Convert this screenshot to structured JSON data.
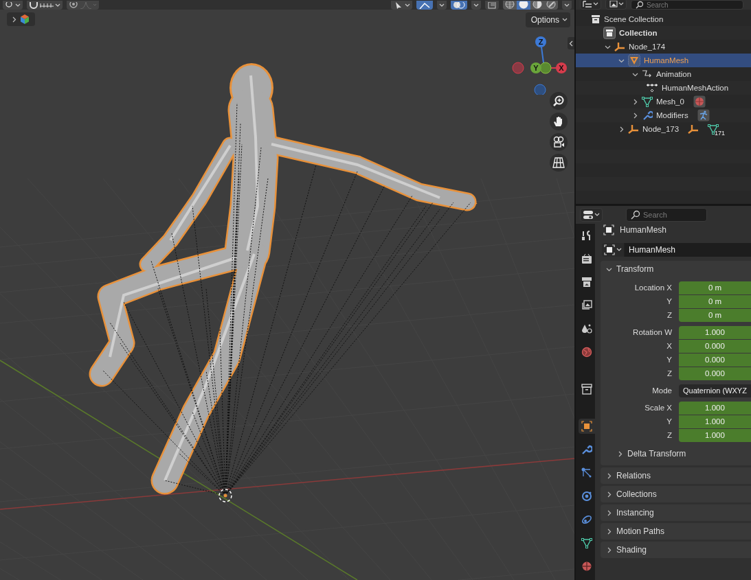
{
  "viewport": {
    "shading_modes": [
      {
        "kind": "wireframe",
        "selected": false
      },
      {
        "kind": "solid",
        "selected": true
      },
      {
        "kind": "material",
        "selected": false
      },
      {
        "kind": "rendered",
        "selected": false
      }
    ],
    "options_button": "Options",
    "toolbar_expanded": false,
    "gizmos_on": true,
    "overlays_on": true,
    "xray_on": false,
    "gizmo_axes": [
      {
        "kind": "z",
        "label": "Z"
      },
      {
        "kind": "y",
        "label": "Y"
      },
      {
        "kind": "x",
        "label": "X"
      }
    ]
  },
  "outliner": {
    "search_placeholder": "Search",
    "tree": [
      {
        "kind": "scene_collection",
        "label": "Scene Collection",
        "selected": false,
        "children": [
          {
            "kind": "collection",
            "label": "Collection",
            "selected": false,
            "children": [
              {
                "kind": "empty",
                "label": "Node_174",
                "selected": false,
                "expanded": true,
                "children": [
                  {
                    "kind": "mesh_object",
                    "label": "HumanMesh",
                    "selected": true,
                    "expanded": true,
                    "children": [
                      {
                        "kind": "animation",
                        "label": "Animation",
                        "selected": false,
                        "expanded": true,
                        "children": [
                          {
                            "kind": "action",
                            "label": "HumanMeshAction",
                            "selected": false
                          }
                        ]
                      },
                      {
                        "kind": "mesh_data",
                        "label": "Mesh_0",
                        "selected": false,
                        "expanded": false,
                        "badges": [
                          {
                            "kind": "material"
                          }
                        ]
                      },
                      {
                        "kind": "modifiers",
                        "label": "Modifiers",
                        "selected": false,
                        "expanded": false,
                        "badges": [
                          {
                            "kind": "armature"
                          }
                        ]
                      }
                    ]
                  },
                  {
                    "kind": "empty",
                    "label": "Node_173",
                    "selected": false,
                    "expanded": false,
                    "badges": [
                      {
                        "kind": "empty"
                      },
                      {
                        "kind": "mesh_data",
                        "count": "171"
                      }
                    ]
                  }
                ]
              }
            ]
          }
        ]
      }
    ]
  },
  "properties": {
    "search_placeholder": "Search",
    "object_name": "HumanMesh",
    "name_field": "HumanMesh",
    "tabs": [
      {
        "kind": "tool",
        "selected": false
      },
      {
        "kind": "render",
        "selected": false
      },
      {
        "kind": "output",
        "selected": false
      },
      {
        "kind": "view_layer",
        "selected": false
      },
      {
        "kind": "scene",
        "selected": false
      },
      {
        "kind": "world",
        "selected": false
      },
      {
        "kind": "collection",
        "selected": false
      },
      {
        "kind": "object",
        "selected": true
      },
      {
        "kind": "modifiers",
        "selected": false
      },
      {
        "kind": "particles",
        "selected": false
      },
      {
        "kind": "physics",
        "selected": false
      },
      {
        "kind": "constraints",
        "selected": false
      },
      {
        "kind": "data",
        "selected": false
      },
      {
        "kind": "material",
        "selected": false
      }
    ],
    "transform": {
      "title": "Transform",
      "expanded": true,
      "groups": [
        {
          "kind": "vector",
          "rows": [
            {
              "label": "Location X",
              "value": "0 m"
            },
            {
              "label": "Y",
              "value": "0 m"
            },
            {
              "label": "Z",
              "value": "0 m"
            }
          ]
        },
        {
          "kind": "vector",
          "rows": [
            {
              "label": "Rotation W",
              "value": "1.000"
            },
            {
              "label": "X",
              "value": "0.000"
            },
            {
              "label": "Y",
              "value": "0.000"
            },
            {
              "label": "Z",
              "value": "0.000"
            }
          ]
        },
        {
          "kind": "dropdown",
          "label": "Mode",
          "value": "Quaternion (WXYZ"
        },
        {
          "kind": "vector",
          "rows": [
            {
              "label": "Scale X",
              "value": "1.000"
            },
            {
              "label": "Y",
              "value": "1.000"
            },
            {
              "label": "Z",
              "value": "1.000"
            }
          ]
        }
      ],
      "subpanel": {
        "title": "Delta Transform",
        "expanded": false
      }
    },
    "panels": [
      {
        "title": "Relations",
        "expanded": false
      },
      {
        "title": "Collections",
        "expanded": false
      },
      {
        "title": "Instancing",
        "expanded": false
      },
      {
        "title": "Motion Paths",
        "expanded": false
      },
      {
        "title": "Shading",
        "expanded": false
      }
    ]
  }
}
